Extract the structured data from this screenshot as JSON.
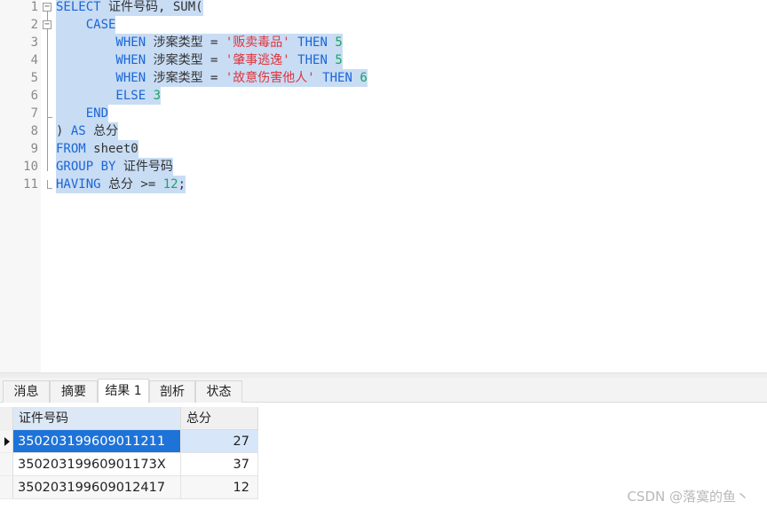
{
  "editor": {
    "lines": [
      {
        "n": "1",
        "tokens": [
          {
            "t": "kw",
            "v": "SELECT"
          },
          {
            "t": "tx",
            "v": " 证件号码, SUM("
          }
        ]
      },
      {
        "n": "2",
        "tokens": [
          {
            "t": "kw",
            "v": "    CASE"
          }
        ]
      },
      {
        "n": "3",
        "tokens": [
          {
            "t": "kw",
            "v": "        WHEN"
          },
          {
            "t": "tx",
            "v": " 涉案类型 = "
          },
          {
            "t": "st",
            "v": "'贩卖毒品'"
          },
          {
            "t": "kw",
            "v": " THEN"
          },
          {
            "t": "tx",
            "v": " "
          },
          {
            "t": "nm",
            "v": "5"
          }
        ]
      },
      {
        "n": "4",
        "tokens": [
          {
            "t": "kw",
            "v": "        WHEN"
          },
          {
            "t": "tx",
            "v": " 涉案类型 = "
          },
          {
            "t": "st",
            "v": "'肇事逃逸'"
          },
          {
            "t": "kw",
            "v": " THEN"
          },
          {
            "t": "tx",
            "v": " "
          },
          {
            "t": "nm",
            "v": "5"
          }
        ]
      },
      {
        "n": "5",
        "tokens": [
          {
            "t": "kw",
            "v": "        WHEN"
          },
          {
            "t": "tx",
            "v": " 涉案类型 = "
          },
          {
            "t": "st",
            "v": "'故意伤害他人'"
          },
          {
            "t": "kw",
            "v": " THEN"
          },
          {
            "t": "tx",
            "v": " "
          },
          {
            "t": "nm",
            "v": "6"
          }
        ]
      },
      {
        "n": "6",
        "tokens": [
          {
            "t": "kw",
            "v": "        ELSE"
          },
          {
            "t": "tx",
            "v": " "
          },
          {
            "t": "nm",
            "v": "3"
          }
        ]
      },
      {
        "n": "7",
        "tokens": [
          {
            "t": "kw",
            "v": "    END"
          }
        ]
      },
      {
        "n": "8",
        "tokens": [
          {
            "t": "tx",
            "v": ")"
          },
          {
            "t": "kw",
            "v": " AS"
          },
          {
            "t": "tx",
            "v": " 总分"
          }
        ]
      },
      {
        "n": "9",
        "tokens": [
          {
            "t": "kw",
            "v": "FROM"
          },
          {
            "t": "tx",
            "v": " sheet0"
          }
        ]
      },
      {
        "n": "10",
        "tokens": [
          {
            "t": "kw",
            "v": "GROUP BY"
          },
          {
            "t": "tx",
            "v": " 证件号码"
          }
        ]
      },
      {
        "n": "11",
        "tokens": [
          {
            "t": "kw",
            "v": "HAVING"
          },
          {
            "t": "tx",
            "v": " 总分 >= "
          },
          {
            "t": "nm",
            "v": "12"
          },
          {
            "t": "tx",
            "v": ";"
          }
        ]
      }
    ]
  },
  "tabs": [
    {
      "label": "消息"
    },
    {
      "label": "摘要"
    },
    {
      "label": "结果 1",
      "active": true
    },
    {
      "label": "剖析"
    },
    {
      "label": "状态"
    }
  ],
  "result": {
    "columns": [
      "证件号码",
      "总分"
    ],
    "rows": [
      [
        "350203199609011211",
        "27"
      ],
      [
        "35020319960901173X",
        "37"
      ],
      [
        "350203199609012417",
        "12"
      ]
    ]
  },
  "watermark": "CSDN @落寞的鱼丶",
  "colors": {
    "keyword": "#1a66d6",
    "string": "#e0343c",
    "number": "#19a564",
    "selection": "#c8dcf4",
    "selected_cell": "#1e73d9"
  }
}
